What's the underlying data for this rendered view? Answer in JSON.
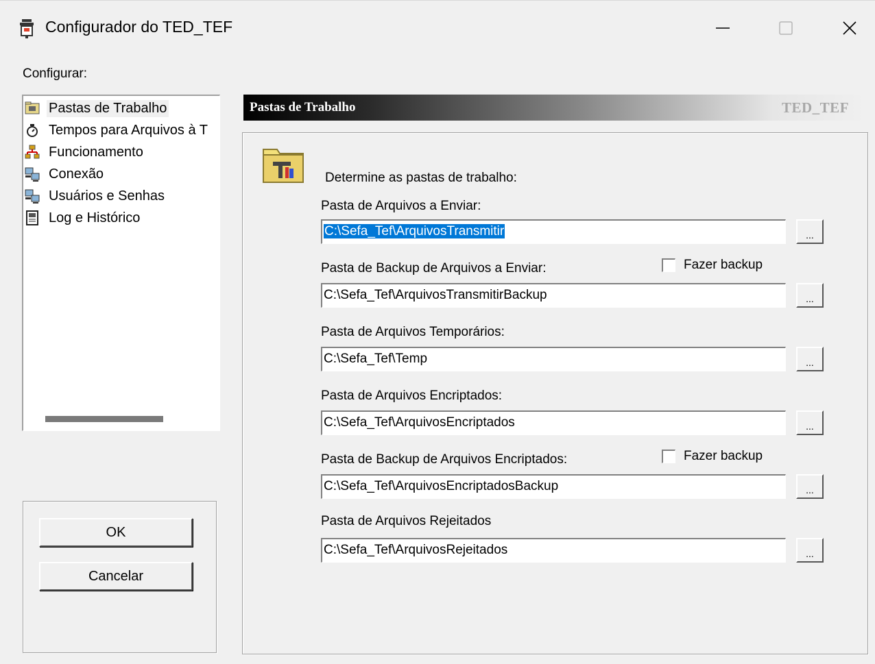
{
  "window": {
    "title": "Configurador do TED_TEF",
    "min_glyph": "—",
    "max_glyph": "☐",
    "close_glyph": "✕"
  },
  "sidebar": {
    "label": "Configurar:",
    "items": [
      {
        "label": "Pastas de Trabalho",
        "icon": "folder-icon",
        "selected": true
      },
      {
        "label": "Tempos para Arquivos à T",
        "icon": "stopwatch-icon"
      },
      {
        "label": "Funcionamento",
        "icon": "network-icon"
      },
      {
        "label": "Conexão",
        "icon": "computers-icon"
      },
      {
        "label": "Usuários e Senhas",
        "icon": "computers-icon"
      },
      {
        "label": "Log e Histórico",
        "icon": "log-book-icon"
      }
    ]
  },
  "buttons": {
    "ok": "OK",
    "cancel": "Cancelar"
  },
  "header": {
    "title": "Pastas de Trabalho",
    "brand": "TED_TEF"
  },
  "main": {
    "instruction": "Determine as pastas de trabalho:",
    "browse_label": "...",
    "fields": [
      {
        "label": "Pasta de Arquivos a Enviar:",
        "value": "C:\\Sefa_Tef\\ArquivosTransmitir",
        "selected": true
      },
      {
        "label": "Pasta de Backup de Arquivos a Enviar:",
        "value": "C:\\Sefa_Tef\\ArquivosTransmitirBackup",
        "checkbox": "Fazer backup",
        "checked": false
      },
      {
        "label": "Pasta de Arquivos Temporários:",
        "value": "C:\\Sefa_Tef\\Temp"
      },
      {
        "label": "Pasta de Arquivos Encriptados:",
        "value": "C:\\Sefa_Tef\\ArquivosEncriptados"
      },
      {
        "label": "Pasta de Backup de Arquivos Encriptados:",
        "value": "C:\\Sefa_Tef\\ArquivosEncriptadosBackup",
        "checkbox": "Fazer backup",
        "checked": false
      },
      {
        "label": "Pasta de Arquivos Rejeitados",
        "value": "C:\\Sefa_Tef\\ArquivosRejeitados"
      }
    ]
  },
  "colors": {
    "selection": "#0078d7",
    "window_bg": "#f0f0f0",
    "header_text": "#ffffff",
    "brand_text": "#a8a8a8"
  }
}
